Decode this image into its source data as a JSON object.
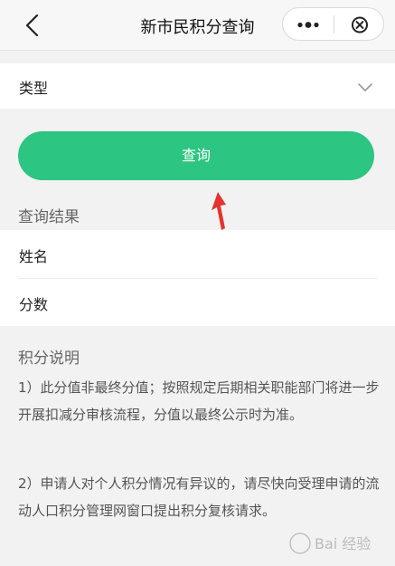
{
  "nav": {
    "title": "新市民积分查询",
    "back_icon": "chevron-left-icon",
    "more_icon": "more-dots-icon",
    "close_icon": "circle-close-icon"
  },
  "filter": {
    "type_label": "类型",
    "dropdown_icon": "chevron-down-icon"
  },
  "query_button": {
    "label": "查询",
    "color": "#2cc582"
  },
  "results": {
    "title": "查询结果",
    "rows": [
      {
        "label": "姓名"
      },
      {
        "label": "分数"
      }
    ]
  },
  "notes": {
    "title": "积分说明",
    "items": [
      "1）此分值非最终分值；按照规定后期相关职能部门将进一步开展扣减分审核流程，分值以最终公示时为准。",
      "2）申请人对个人积分情况有异议的，请尽快向受理申请的流动人口积分管理网窗口提出积分复核请求。"
    ]
  },
  "watermark": {
    "text": "Bai 经验"
  }
}
